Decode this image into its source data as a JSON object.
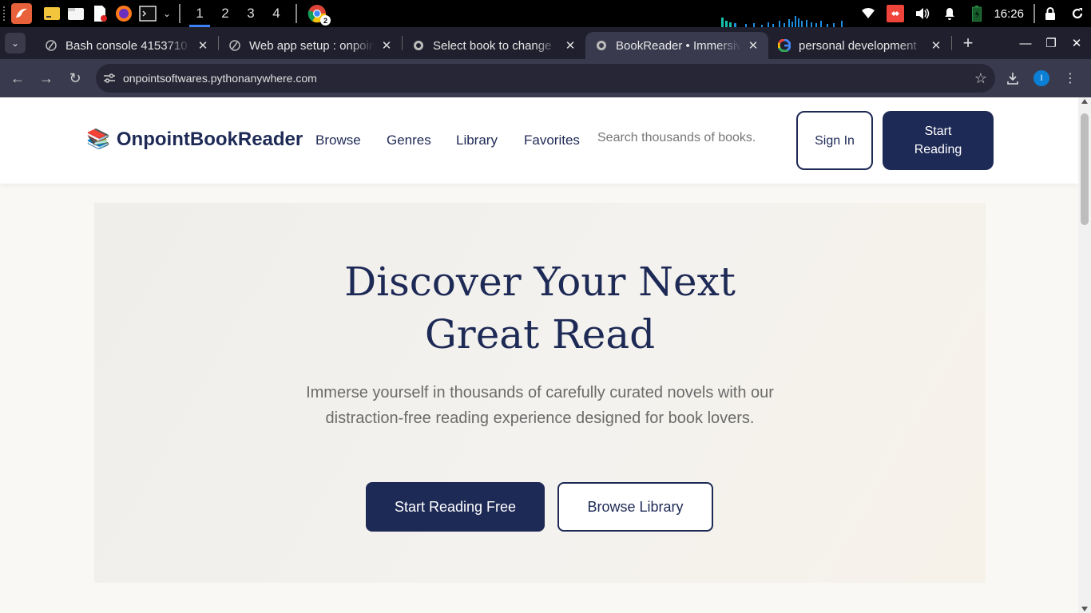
{
  "taskbar": {
    "workspaces": [
      "1",
      "2",
      "3",
      "4"
    ],
    "active_workspace": "1",
    "chrome_badge": "2",
    "clock": "16:26"
  },
  "tabs": [
    {
      "title": "Bash console 4153710",
      "favicon": "pythonanywhere-icon"
    },
    {
      "title": "Web app setup : onpointsoftwares",
      "favicon": "pythonanywhere-icon"
    },
    {
      "title": "Select book to change",
      "favicon": "globe-icon"
    },
    {
      "title": "BookReader • Immersive Reading",
      "favicon": "globe-icon",
      "active": true
    },
    {
      "title": "personal development",
      "favicon": "google-icon"
    }
  ],
  "address_bar": {
    "url": "onpointsoftwares.pythonanywhere.com",
    "profile_initial": "I"
  },
  "site": {
    "brand": "OnpointBookReader",
    "brand_icon": "📚",
    "nav": [
      "Browse",
      "Genres",
      "Library",
      "Favorites"
    ],
    "search_placeholder": "Search thousands of books.",
    "sign_in_label": "Sign In",
    "start_reading_label": "Start Reading"
  },
  "hero": {
    "title_line1": "Discover Your Next",
    "title_line2": "Great Read",
    "subtitle": "Immerse yourself in thousands of carefully curated novels with our distraction-free reading experience designed for book lovers.",
    "primary_cta": "Start Reading Free",
    "secondary_cta": "Browse Library"
  },
  "colors": {
    "brand_navy": "#1e2a56",
    "page_bg": "#faf8f4",
    "hero_bg": "#f1efeb"
  }
}
